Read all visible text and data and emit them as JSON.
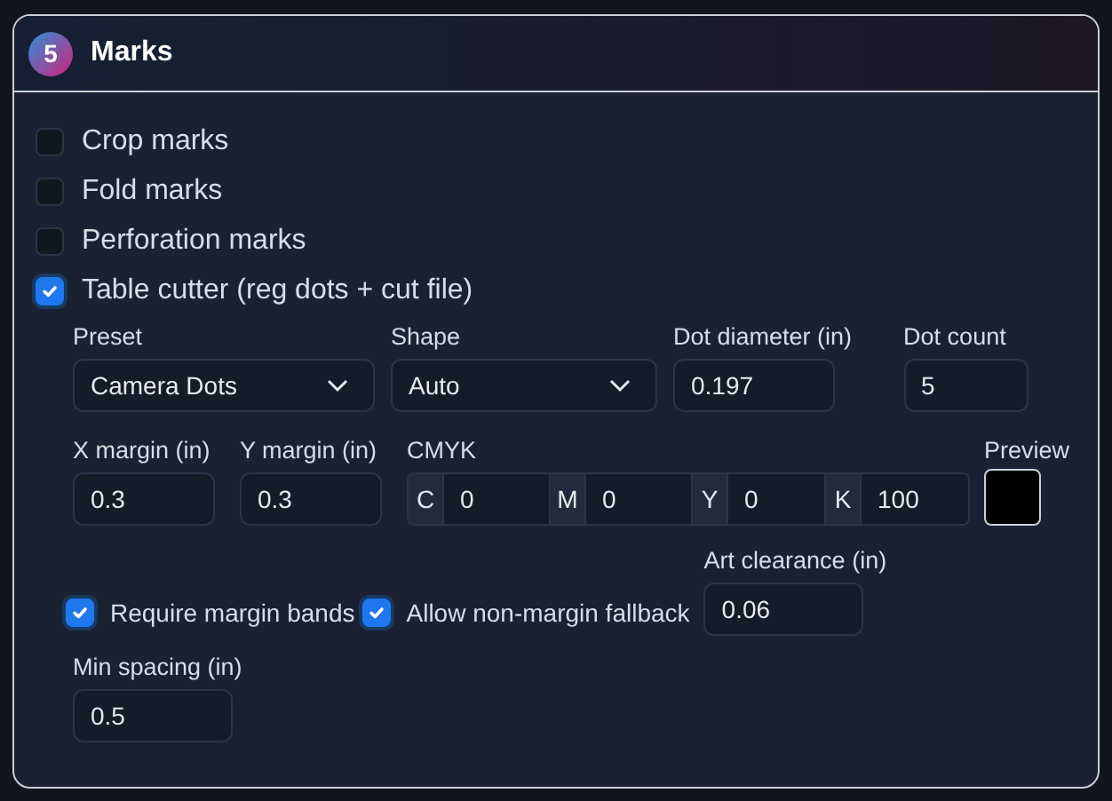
{
  "panel": {
    "step": "5",
    "title": "Marks"
  },
  "options": [
    {
      "label": "Crop marks",
      "checked": false
    },
    {
      "label": "Fold marks",
      "checked": false
    },
    {
      "label": "Perforation marks",
      "checked": false
    },
    {
      "label": "Table cutter (reg dots + cut file)",
      "checked": true
    }
  ],
  "cutter": {
    "row1": [
      {
        "kind": "select",
        "label": "Preset",
        "value": "Camera Dots"
      },
      {
        "kind": "select",
        "label": "Shape",
        "value": "Auto"
      },
      {
        "kind": "input",
        "label": "Dot diameter (in)",
        "value": "0.197"
      },
      {
        "kind": "input",
        "label": "Dot count",
        "value": "5"
      }
    ],
    "margins": [
      {
        "label": "X margin (in)",
        "value": "0.3"
      },
      {
        "label": "Y margin (in)",
        "value": "0.3"
      }
    ],
    "cmyk": {
      "label": "CMYK",
      "channels": [
        {
          "letter": "C",
          "value": "0"
        },
        {
          "letter": "M",
          "value": "0"
        },
        {
          "letter": "Y",
          "value": "0"
        },
        {
          "letter": "K",
          "value": "100"
        }
      ]
    },
    "preview": {
      "label": "Preview"
    },
    "toggles": [
      {
        "label": "Require margin bands",
        "checked": true
      },
      {
        "label": "Allow non-margin fallback",
        "checked": true
      }
    ],
    "art_clearance": {
      "label": "Art clearance (in)",
      "value": "0.06"
    },
    "min_spacing": {
      "label": "Min spacing (in)",
      "value": "0.5"
    }
  }
}
